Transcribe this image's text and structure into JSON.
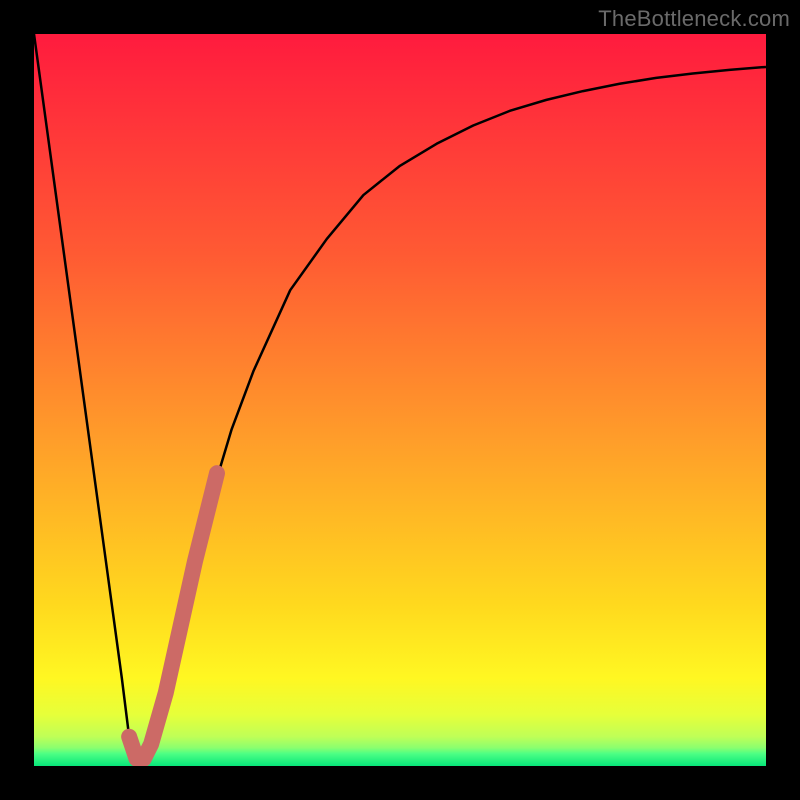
{
  "watermark": {
    "text": "TheBottleneck.com"
  },
  "colors": {
    "gradient": [
      "#ff1b3e",
      "#ff5a33",
      "#ff9c2a",
      "#ffd91e",
      "#fff722",
      "#e6ff3a",
      "#bfff57",
      "#8bff6f",
      "#4eff84",
      "#07e67a"
    ],
    "curve_black": "#000000",
    "highlight": "#cc6a66"
  },
  "chart_data": {
    "type": "line",
    "title": "",
    "xlabel": "",
    "ylabel": "",
    "xlim": [
      0,
      100
    ],
    "ylim": [
      0,
      100
    ],
    "grid": false,
    "series": [
      {
        "name": "black-curve",
        "x": [
          0,
          3,
          6,
          9,
          12,
          13,
          14,
          15,
          16,
          18,
          20,
          22,
          24,
          27,
          30,
          35,
          40,
          45,
          50,
          55,
          60,
          65,
          70,
          75,
          80,
          85,
          90,
          95,
          100
        ],
        "values": [
          100,
          78,
          56,
          34,
          12,
          4,
          1,
          1,
          3,
          10,
          19,
          28,
          36,
          46,
          54,
          65,
          72,
          78,
          82,
          85,
          87.5,
          89.5,
          91,
          92.2,
          93.2,
          94,
          94.6,
          95.1,
          95.5
        ]
      },
      {
        "name": "highlight-segment",
        "x": [
          13,
          14,
          15,
          16,
          18,
          20,
          22,
          24,
          25
        ],
        "values": [
          4,
          1,
          1,
          3,
          10,
          19,
          28,
          36,
          40
        ]
      }
    ],
    "annotations": []
  }
}
